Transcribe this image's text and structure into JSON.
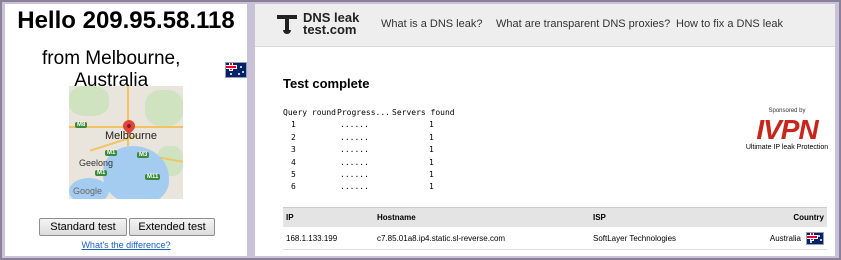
{
  "left": {
    "greeting": "Hello 209.95.58.118",
    "location": "from Melbourne, Australia",
    "map": {
      "city_label": "Melbourne",
      "geelong_label": "Geelong",
      "google_label": "Google",
      "shields": [
        "M8",
        "M3",
        "M1",
        "M11",
        "M1"
      ]
    },
    "standard_test_label": "Standard test",
    "extended_test_label": "Extended test",
    "difference_link": "What's the difference?"
  },
  "nav": {
    "logo_line1": "DNS leak",
    "logo_line2": "test.com",
    "links": [
      "What is a DNS leak?",
      "What are transparent DNS proxies?",
      "How to fix a DNS leak"
    ]
  },
  "status_title": "Test complete",
  "query_table": {
    "headers": [
      "Query round",
      "Progress...",
      "Servers found"
    ],
    "rows": [
      {
        "round": "1",
        "progress": "......",
        "servers": "1"
      },
      {
        "round": "2",
        "progress": "......",
        "servers": "1"
      },
      {
        "round": "3",
        "progress": "......",
        "servers": "1"
      },
      {
        "round": "4",
        "progress": "......",
        "servers": "1"
      },
      {
        "round": "5",
        "progress": "......",
        "servers": "1"
      },
      {
        "round": "6",
        "progress": "......",
        "servers": "1"
      }
    ]
  },
  "sponsor": {
    "sponsored_by": "Sponsored by",
    "brand": "IVPN",
    "tagline": "Ultimate IP leak Protection"
  },
  "results": {
    "headers": {
      "ip": "IP",
      "hostname": "Hostname",
      "isp": "ISP",
      "country": "Country"
    },
    "rows": [
      {
        "ip": "168.1.133.199",
        "hostname": "c7.85.01a8.ip4.static.sl-reverse.com",
        "isp": "SoftLayer Technologies",
        "country": "Australia"
      }
    ]
  },
  "colors": {
    "brand_red": "#c8261c",
    "link_blue": "#1a5fc0"
  }
}
